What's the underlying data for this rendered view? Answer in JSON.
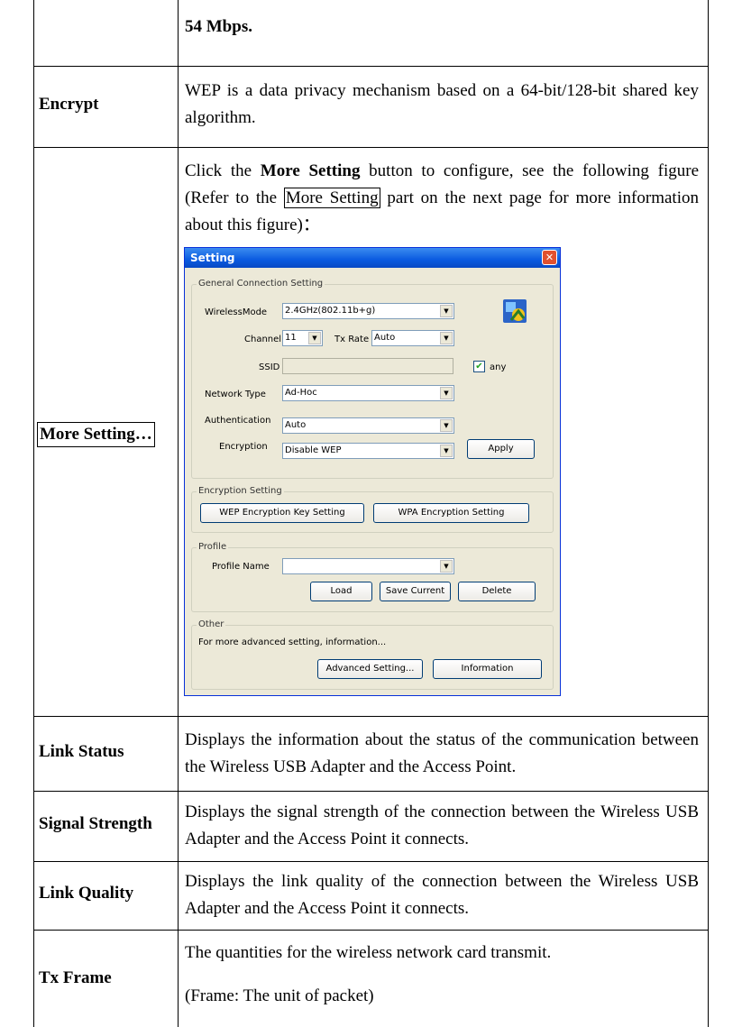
{
  "rows": [
    {
      "label": "",
      "desc": [
        "54 Mbps."
      ]
    },
    {
      "label": "Encrypt",
      "desc": [
        "WEP is a data privacy mechanism based on a 64-bit/128-bit shared key algorithm."
      ]
    },
    {
      "label": "More Setting…",
      "desc_parts": {
        "pre": "Click the ",
        "bold": "More Setting",
        "mid": " button to configure, see the following figure (Refer to the ",
        "boxed": "More Setting",
        "post": " part on the next page for more information about this figure)："
      }
    },
    {
      "label": "Link Status",
      "desc": [
        "Displays the information about the status of the communication between the Wireless USB Adapter and the Access Point."
      ]
    },
    {
      "label": "Signal Strength",
      "desc": [
        "Displays the signal strength of the connection between the Wireless USB Adapter and the Access Point it connects."
      ]
    },
    {
      "label": "Link Quality",
      "desc": [
        "Displays the link quality of the connection between the Wireless USB Adapter and the Access Point it connects."
      ]
    },
    {
      "label": "Tx Frame",
      "desc": [
        "The quantities for the wireless network card transmit.",
        "(Frame: The unit of packet)"
      ]
    }
  ],
  "dialog": {
    "title": "Setting",
    "close_glyph": "✕",
    "general": {
      "title": "General Connection Setting",
      "wireless_mode_label": "WirelessMode",
      "wireless_mode_value": "2.4GHz(802.11b+g)",
      "channel_label": "Channel",
      "channel_value": "11",
      "tx_rate_label": "Tx Rate",
      "tx_rate_value": "Auto",
      "ssid_label": "SSID",
      "ssid_value": "",
      "any_label": "any",
      "any_checked": true,
      "network_type_label": "Network Type",
      "network_type_value": "Ad-Hoc",
      "authentication_label": "Authentication",
      "authentication_value": "Auto",
      "encryption_label": "Encryption",
      "encryption_value": "Disable WEP",
      "apply_label": "Apply",
      "icon": "wireless-network-icon"
    },
    "encryption": {
      "title": "Encryption Setting",
      "wep_button": "WEP Encryption Key Setting",
      "wpa_button": "WPA Encryption Setting"
    },
    "profile": {
      "title": "Profile",
      "profile_name_label": "Profile Name",
      "profile_name_value": "",
      "load_button": "Load",
      "save_button": "Save Current",
      "delete_button": "Delete"
    },
    "other": {
      "title": "Other",
      "text": "For more advanced setting, information...",
      "advanced_button": "Advanced Setting...",
      "information_button": "Information"
    },
    "dropdown_glyph": "▼",
    "check_glyph": "✔"
  }
}
